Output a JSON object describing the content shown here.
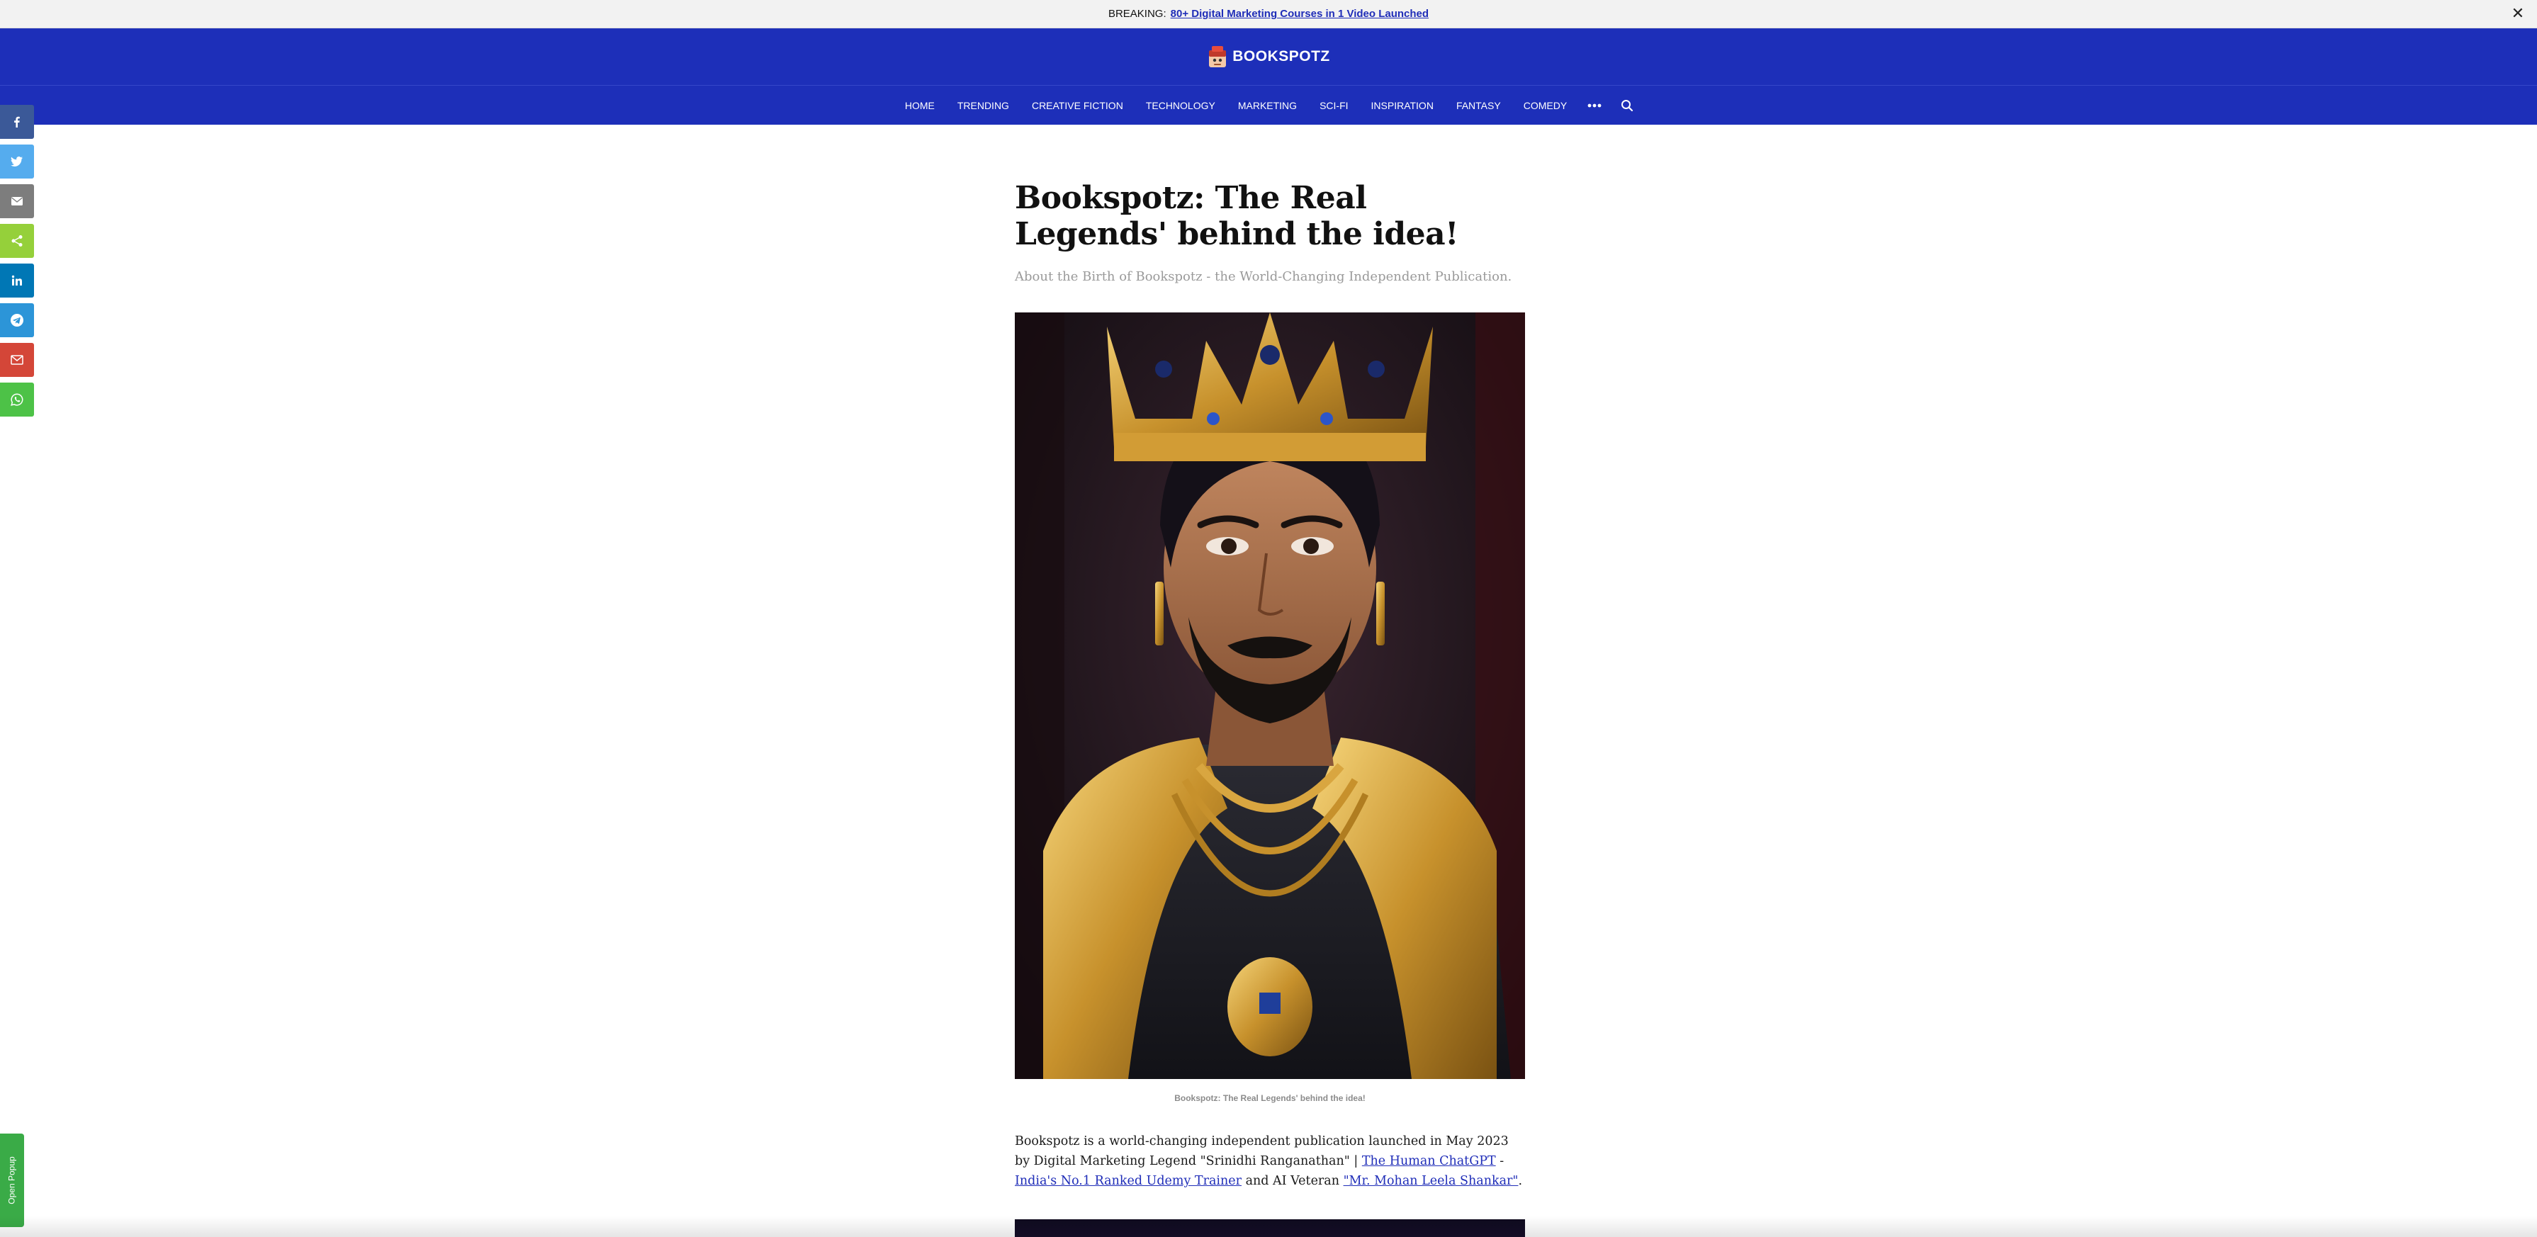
{
  "breaking": {
    "label": "BREAKING:",
    "link": "80+ Digital Marketing Courses in 1 Video Launched",
    "close": "✕"
  },
  "header": {
    "logo_text": "BOOKSPOTZ"
  },
  "nav": {
    "items": [
      "HOME",
      "TRENDING",
      "CREATIVE FICTION",
      "TECHNOLOGY",
      "MARKETING",
      "SCI-FI",
      "INSPIRATION",
      "FANTASY",
      "COMEDY"
    ],
    "more_icon": "more-dots-icon",
    "search_icon": "search-icon"
  },
  "share": {
    "buttons": [
      {
        "name": "facebook",
        "color": "#3b5998"
      },
      {
        "name": "twitter",
        "color": "#55acee"
      },
      {
        "name": "email",
        "color": "#7d7d7d"
      },
      {
        "name": "share",
        "color": "#95d03a"
      },
      {
        "name": "linkedin",
        "color": "#0077b5"
      },
      {
        "name": "telegram",
        "color": "#2c95d8"
      },
      {
        "name": "gmail",
        "color": "#d44638"
      },
      {
        "name": "whatsapp",
        "color": "#4dc247"
      }
    ]
  },
  "article": {
    "title": "Bookspotz: The Real Legends' behind the idea!",
    "subtitle": "About the Birth of Bookspotz - the World-Changing Independent Publication.",
    "caption": "Bookspotz: The Real Legends' behind the idea!",
    "body": {
      "part1": "Bookspotz is a world-changing independent publication launched in May 2023 by Digital Marketing Legend \"Srinidhi Ranganathan\" | ",
      "link1": "The Human ChatGPT",
      "part2": " - ",
      "link2": "India's No.1 Ranked Udemy Trainer",
      "part3": " and AI Veteran ",
      "link3": "\"Mr. Mohan Leela Shankar\"",
      "part4": "."
    }
  },
  "popup": {
    "label": "Open Popup"
  },
  "colors": {
    "brand_blue": "#1d2fb9",
    "link_blue": "#1f2db8",
    "popup_green": "#3aab47"
  }
}
